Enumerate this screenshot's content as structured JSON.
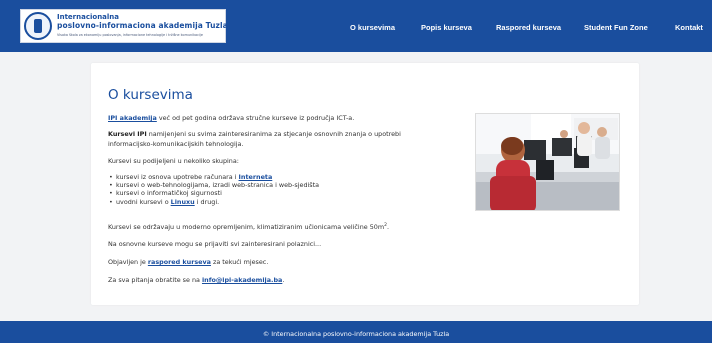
{
  "header": {
    "logo": {
      "line1": "Internacionalna",
      "line2": "poslovno-informaciona akademija Tuzla",
      "line3": "Visoka škola za ekonomiju poslovanja, informacione tehnologije i tržišne komunikacije"
    },
    "nav": [
      "O kursevima",
      "Popis kurseva",
      "Raspored kurseva",
      "Student Fun Zone",
      "Kontakt"
    ],
    "bg_color": "#1a4e9e"
  },
  "content": {
    "title": "O kursevima",
    "p1": {
      "link": "IPI akademija",
      "text": " već od pet godina održava stručne kurseve iz područja ICT-a."
    },
    "p2": {
      "bold": "Kursevi IPI",
      "text": " namijenjeni su svima zainteresiranima za stjecanje osnovnih znanja o upotrebi",
      "line2": "informacijsko-komunikacijskih tehnologija."
    },
    "p3": "Kursevi su podijeljeni u nekoliko skupina:",
    "list": {
      "item1_text": "kursevi iz osnova upotrebe računara i ",
      "item1_link": "Interneta",
      "item2": "kursevi o web-tehnologijama, izradi web-stranica i web-sjedišta",
      "item3": "kursevi o informatičkoj sigurnosti",
      "item4_text": "uvodni kursevi o ",
      "item4_link": "Linuxu",
      "item4_after": " i drugi."
    },
    "p4_text": "Kursevi se održavaju u moderno opremljenim, klimatiziranim učionicama veličine 50m",
    "p4_sup": "2",
    "p4_end": ".",
    "p5": "Na osnovne kurseve mogu se prijaviti svi zainteresirani polaznici...",
    "p6": {
      "text": "Objavljen je ",
      "link": "raspored kurseva",
      "after": " za tekući mjesec."
    },
    "p7": {
      "text": "Za sva pitanja obratite se na ",
      "link": "info@ipi-akademija.ba",
      "after": "."
    }
  },
  "footer": {
    "text": "© Internacionalna poslovno-informaciona akademija Tuzla"
  }
}
